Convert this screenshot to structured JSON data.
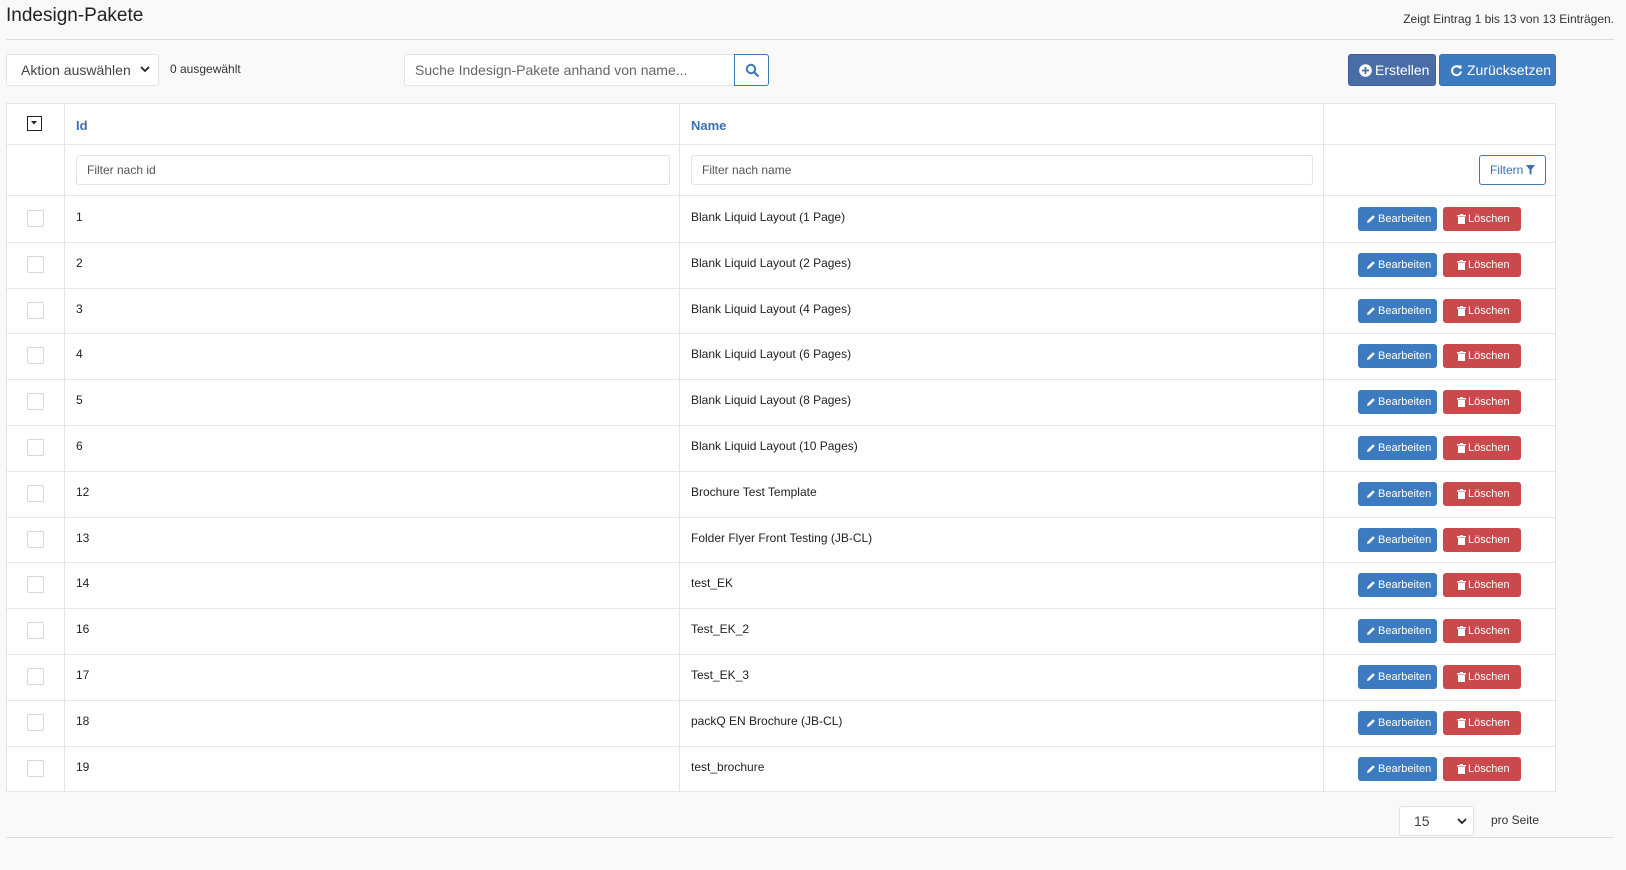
{
  "header": {
    "title": "Indesign-Pakete",
    "entries_info": "Zeigt Eintrag 1 bis 13 von 13 Einträgen."
  },
  "toolbar": {
    "action_select": "Aktion auswählen",
    "selected_count": "0 ausgewählt",
    "search_placeholder": "Suche Indesign-Pakete anhand von name...",
    "create_label": "Erstellen",
    "reset_label": "Zurücksetzen"
  },
  "table": {
    "columns": {
      "id": "Id",
      "name": "Name"
    },
    "filters": {
      "id_placeholder": "Filter nach id",
      "name_placeholder": "Filter nach name",
      "filter_button": "Filtern"
    },
    "edit_label": "Bearbeiten",
    "delete_label": "Löschen",
    "rows": [
      {
        "id": "1",
        "name": "Blank Liquid Layout (1 Page)"
      },
      {
        "id": "2",
        "name": "Blank Liquid Layout (2 Pages)"
      },
      {
        "id": "3",
        "name": "Blank Liquid Layout (4 Pages)"
      },
      {
        "id": "4",
        "name": "Blank Liquid Layout (6 Pages)"
      },
      {
        "id": "5",
        "name": "Blank Liquid Layout (8 Pages)"
      },
      {
        "id": "6",
        "name": "Blank Liquid Layout (10 Pages)"
      },
      {
        "id": "12",
        "name": "Brochure Test Template"
      },
      {
        "id": "13",
        "name": "Folder Flyer Front Testing (JB-CL)"
      },
      {
        "id": "14",
        "name": "test_EK"
      },
      {
        "id": "16",
        "name": "Test_EK_2"
      },
      {
        "id": "17",
        "name": "Test_EK_3"
      },
      {
        "id": "18",
        "name": "packQ EN Brochure (JB-CL)"
      },
      {
        "id": "19",
        "name": "test_brochure"
      }
    ]
  },
  "pagination": {
    "per_page_value": "15",
    "per_page_label": "pro Seite"
  },
  "colors": {
    "primary": "#3d7bc0",
    "create": "#4a6da7",
    "danger": "#c9494d",
    "link": "#3d6fb0"
  }
}
